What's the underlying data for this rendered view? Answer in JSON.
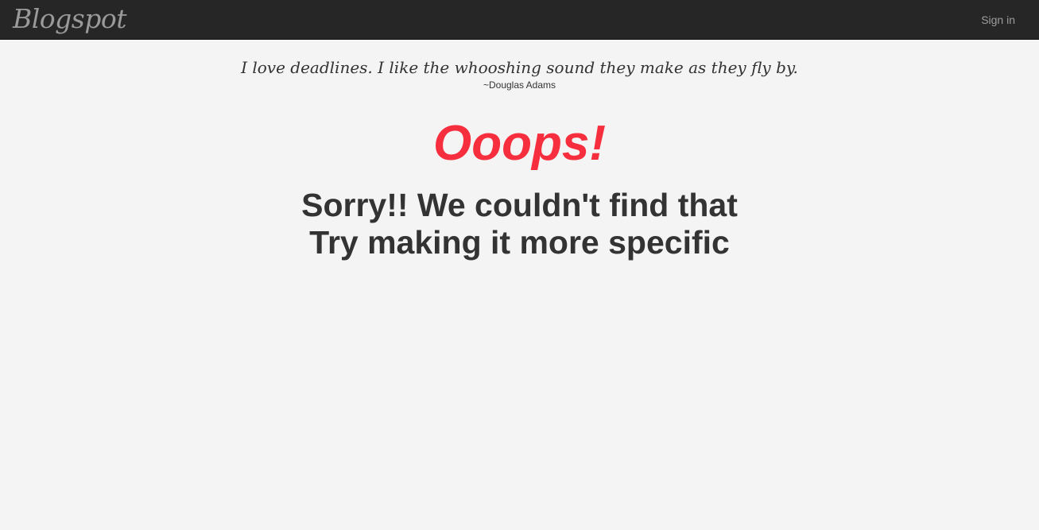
{
  "navbar": {
    "brand": "Blogspot",
    "signin_label": "Sign in"
  },
  "quote": {
    "text": "I love deadlines. I like the whooshing sound they make as they fly by.",
    "author": "~Douglas Adams"
  },
  "error": {
    "heading": "Ooops!",
    "line1": "Sorry!! We couldn't find that",
    "line2": "Try making it more specific"
  },
  "colors": {
    "navbar_bg": "#262626",
    "page_bg": "#f4f4f4",
    "accent_red": "#f62e3d",
    "text_dark": "#333333",
    "nav_text": "#9d9d9d"
  }
}
